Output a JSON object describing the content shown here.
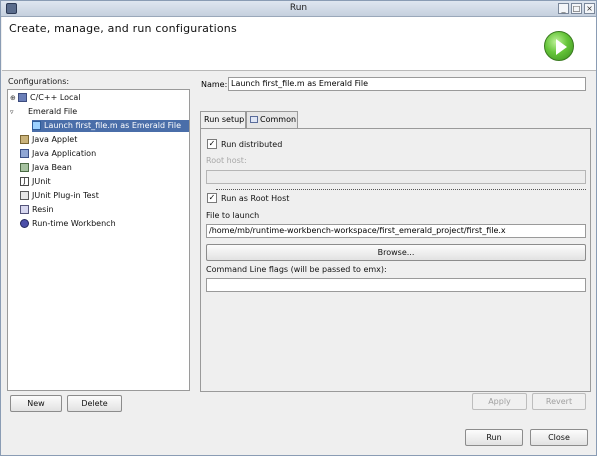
{
  "window": {
    "title": "Run"
  },
  "header": {
    "heading": "Create, manage, and run configurations"
  },
  "left": {
    "label": "Configurations:",
    "items": [
      {
        "label": "C/C++ Local",
        "icon": "cpp-icon"
      },
      {
        "label": "Emerald File",
        "icon": "emerald-icon"
      },
      {
        "label": "Launch first_file.m as Emerald File",
        "icon": "emerald-config-icon"
      },
      {
        "label": "Java Applet",
        "icon": "java-applet-icon"
      },
      {
        "label": "Java Application",
        "icon": "java-app-icon"
      },
      {
        "label": "Java Bean",
        "icon": "java-bean-icon"
      },
      {
        "label": "JUnit",
        "icon": "junit-icon"
      },
      {
        "label": "JUnit Plug-in Test",
        "icon": "junit-plugin-icon"
      },
      {
        "label": "Resin",
        "icon": "resin-icon"
      },
      {
        "label": "Run-time Workbench",
        "icon": "workbench-icon"
      }
    ],
    "new_label": "New",
    "delete_label": "Delete"
  },
  "right": {
    "name_label": "Name:",
    "name_value": "Launch first_file.m as Emerald File",
    "tabs": [
      {
        "label": "Run setup"
      },
      {
        "label": "Common"
      }
    ],
    "run_distributed_label": "Run distributed",
    "run_distributed_checked": true,
    "root_host_label": "Root host:",
    "root_host_value": "",
    "run_as_root_host_label": "Run as Root Host",
    "run_as_root_host_checked": true,
    "file_to_launch_label": "File to launch",
    "file_to_launch_value": "/home/mb/runtime-workbench-workspace/first_emerald_project/first_file.x",
    "browse_label": "Browse...",
    "cmd_flags_label": "Command Line flags (will be passed to emx):",
    "cmd_flags_value": "",
    "apply_label": "Apply",
    "revert_label": "Revert"
  },
  "footer": {
    "run_label": "Run",
    "close_label": "Close"
  }
}
